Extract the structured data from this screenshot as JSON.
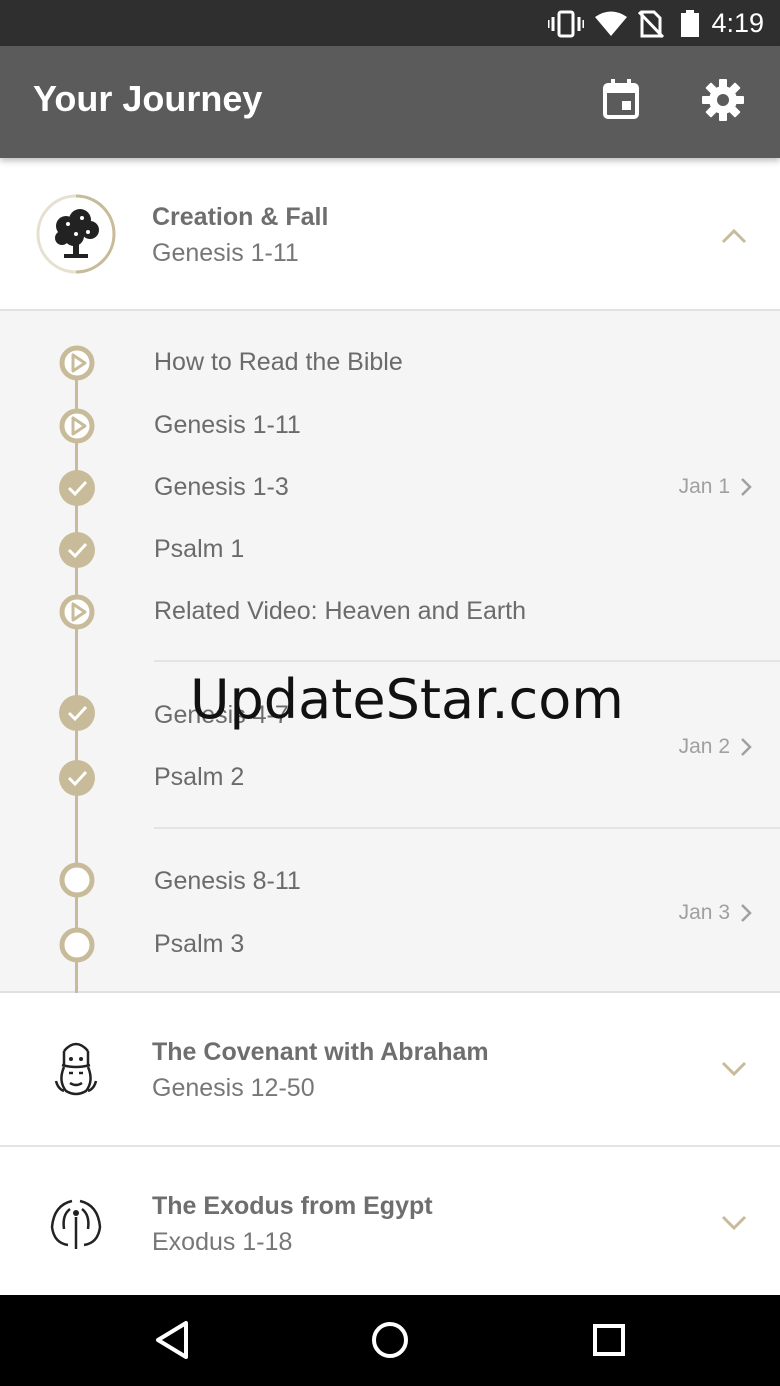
{
  "status_bar": {
    "time": "4:19",
    "icons": [
      "vibrate-icon",
      "wifi-icon",
      "no-sim-icon",
      "battery-icon"
    ]
  },
  "app_bar": {
    "title": "Your Journey",
    "actions": [
      "calendar-icon",
      "gear-icon"
    ]
  },
  "sections": [
    {
      "title": "Creation & Fall",
      "subtitle": "Genesis 1-11",
      "icon": "tree-icon",
      "expanded": true
    },
    {
      "title": "The Covenant with Abraham",
      "subtitle": "Genesis 12-50",
      "icon": "abraham-face-icon",
      "expanded": false
    },
    {
      "title": "The Exodus from Egypt",
      "subtitle": "Exodus 1-18",
      "icon": "sea-parting-icon",
      "expanded": false
    }
  ],
  "readings": {
    "groups": [
      {
        "date": "Jan 1",
        "items": [
          {
            "label": "How to Read the Bible",
            "status": "video"
          },
          {
            "label": "Genesis 1-11",
            "status": "video"
          },
          {
            "label": "Genesis 1-3",
            "status": "done"
          },
          {
            "label": "Psalm 1",
            "status": "done"
          },
          {
            "label": "Related Video: Heaven and Earth",
            "status": "video"
          }
        ]
      },
      {
        "date": "Jan 2",
        "items": [
          {
            "label": "Genesis 4-7",
            "status": "done"
          },
          {
            "label": "Psalm 2",
            "status": "done"
          }
        ]
      },
      {
        "date": "Jan 3",
        "items": [
          {
            "label": "Genesis 8-11",
            "status": "todo"
          },
          {
            "label": "Psalm 3",
            "status": "todo"
          }
        ]
      }
    ]
  },
  "watermark": "UpdateStar.com",
  "colors": {
    "status_bar": "#2f2f2f",
    "app_bar": "#5b5b5b",
    "accent": "#c8bb99",
    "expanded_bg": "#f5f5f5"
  },
  "nav_bar": [
    "back-icon",
    "home-icon",
    "recents-icon"
  ]
}
